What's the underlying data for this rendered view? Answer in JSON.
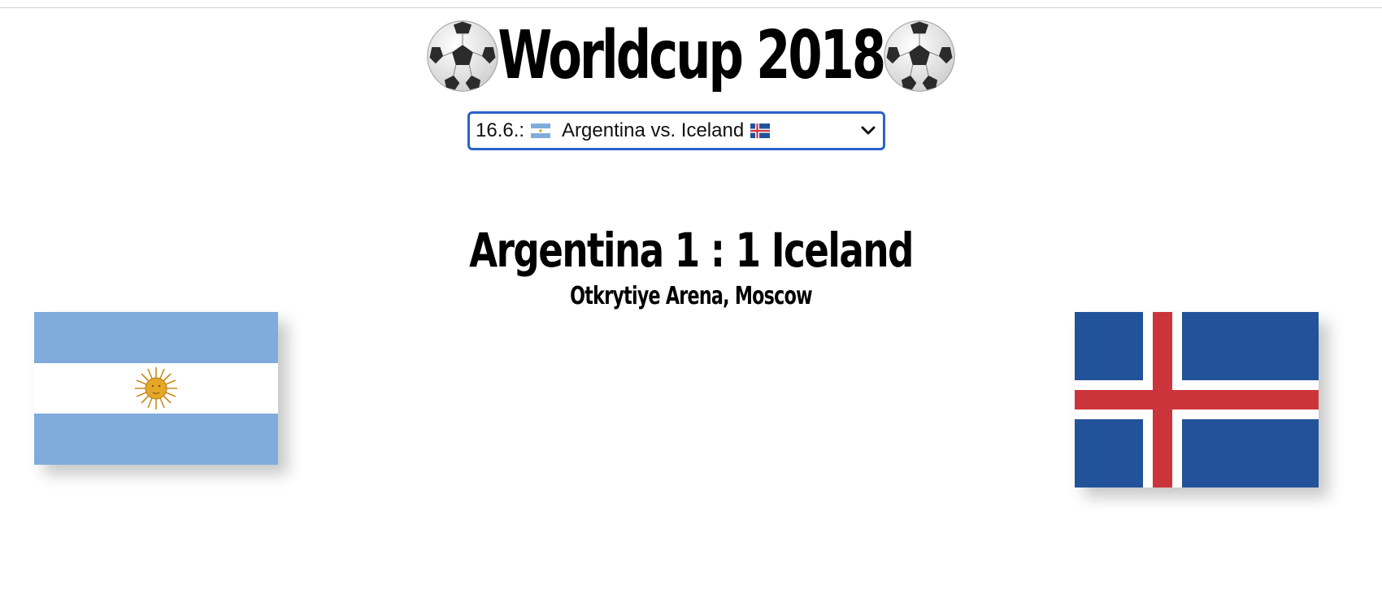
{
  "header": {
    "title": "Worldcup 2018",
    "left_icon": "soccer-ball-icon",
    "right_icon": "soccer-ball-icon"
  },
  "match_select": {
    "selected_date": "16.6.:",
    "selected_match": "Argentina vs. Iceland",
    "home_flag_icon": "argentina-flag-icon",
    "away_flag_icon": "iceland-flag-icon",
    "dropdown_icon": "chevron-down-icon"
  },
  "match": {
    "home_team": "Argentina",
    "home_score": "1",
    "separator": ":",
    "away_score": "1",
    "away_team": "Iceland",
    "venue": "Otkrytiye Arena, Moscow"
  },
  "flags": {
    "home": "argentina-flag",
    "away": "iceland-flag"
  },
  "colors": {
    "select_border": "#2a62c9",
    "argentina_blue": "#80acdc",
    "argentina_sun": "#e6a627",
    "iceland_blue": "#22529a",
    "iceland_red": "#cc343b"
  }
}
